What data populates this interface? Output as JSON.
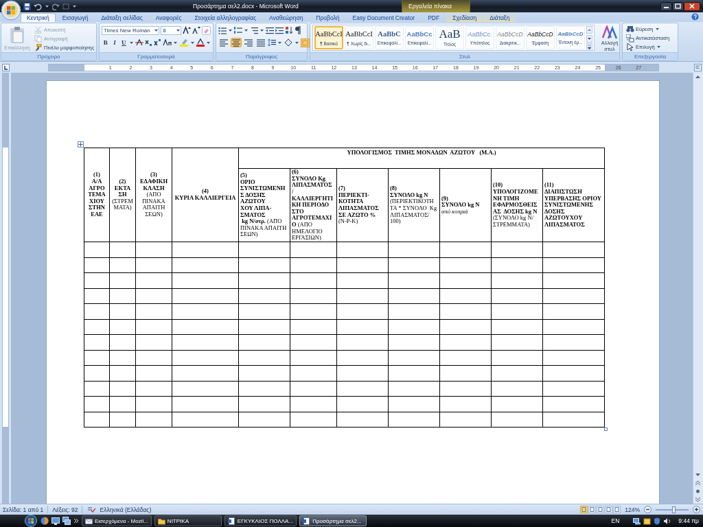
{
  "window": {
    "title": "Προσάρτημα σελ2.docx - Microsoft Word",
    "contextual_group": "Εργαλεία πίνακα"
  },
  "tabs": [
    {
      "label": "Κεντρική",
      "selected": true,
      "kind": "main"
    },
    {
      "label": "Εισαγωγή",
      "selected": false,
      "kind": "main"
    },
    {
      "label": "Διάταξη σελίδας",
      "selected": false,
      "kind": "main"
    },
    {
      "label": "Αναφορές",
      "selected": false,
      "kind": "main"
    },
    {
      "label": "Στοιχεία αλληλογραφίας",
      "selected": false,
      "kind": "main"
    },
    {
      "label": "Αναθεώρηση",
      "selected": false,
      "kind": "main"
    },
    {
      "label": "Προβολή",
      "selected": false,
      "kind": "main"
    },
    {
      "label": "Easy Document Creator",
      "selected": false,
      "kind": "main"
    },
    {
      "label": "PDF",
      "selected": false,
      "kind": "main"
    },
    {
      "label": "Σχεδίαση",
      "selected": false,
      "kind": "contextual"
    },
    {
      "label": "Διάταξη",
      "selected": false,
      "kind": "contextual"
    }
  ],
  "clipboard": {
    "label": "Πρόχειρο",
    "paste": {
      "label": "Επικόλληση",
      "disabled": true
    },
    "items": [
      {
        "label": "Αποκοπή",
        "disabled": true
      },
      {
        "label": "Αντιγραφή",
        "disabled": true
      },
      {
        "label": "Πινέλο μορφοποίησης",
        "disabled": false
      }
    ]
  },
  "font": {
    "label": "Γραμματοσειρά",
    "font_name": "Times New Roman",
    "font_size": "8",
    "format_buttons": [
      {
        "label": "B"
      },
      {
        "label": "I"
      },
      {
        "label": "U"
      }
    ]
  },
  "paragraph": {
    "label": "Παράγραφος",
    "alignments": [
      {
        "kind": "left",
        "selected": false
      },
      {
        "kind": "center",
        "selected": true
      },
      {
        "kind": "right",
        "selected": false
      },
      {
        "kind": "justify",
        "selected": false
      }
    ]
  },
  "styles": {
    "label": "Στυλ",
    "change_styles": "Αλλαγή στυλ",
    "items": [
      {
        "preview": "AaBbCcI",
        "name": "¶ Βασικό",
        "kind": "normal",
        "selected": true
      },
      {
        "preview": "AaBbCcI",
        "name": "¶ Χωρίς δι...",
        "kind": "normal",
        "selected": false
      },
      {
        "preview": "AaBbC",
        "name": "Επικεφαλί...",
        "kind": "heading1",
        "selected": false
      },
      {
        "preview": "AaBbCc",
        "name": "Επικεφαλί...",
        "kind": "heading2",
        "selected": false
      },
      {
        "preview": "AaB",
        "name": "Τίτλος",
        "kind": "title",
        "selected": false
      },
      {
        "preview": "AaBbCc.",
        "name": "Υπότιτλος",
        "kind": "subtitle",
        "selected": false
      },
      {
        "preview": "AaBbCcD",
        "name": "Διακριτικ...",
        "kind": "subtle",
        "selected": false
      },
      {
        "preview": "AaBbCcD",
        "name": "Έμφαση",
        "kind": "emphasis",
        "selected": false
      },
      {
        "preview": "AaBbCcD",
        "name": "Έντονη έμ...",
        "kind": "intense",
        "selected": false
      }
    ]
  },
  "editing": {
    "label": "Επεξεργασία",
    "items": [
      {
        "label": "Εύρεση",
        "kind": "find"
      },
      {
        "label": "Αντικατάσταση",
        "kind": "replace"
      },
      {
        "label": "Επιλογή",
        "kind": "select"
      }
    ]
  },
  "ruler": {
    "numbers": [
      "1",
      "2",
      "3",
      "4",
      "5",
      "6",
      "7",
      "8",
      "9",
      "10",
      "11",
      "12",
      "13",
      "14",
      "15",
      "16",
      "17",
      "18",
      "19",
      "20",
      "21",
      "22",
      "23",
      "24",
      "25",
      "26",
      "27"
    ]
  },
  "table": {
    "title": "ΥΠΟΛΟΓΙΣΜΟΣ  ΤΙΜΗΣ ΜΟΝΑΔΩΝ  ΑΖΩΤΟΥ   (Μ.Α.)",
    "header_cells": [
      "**(1)**\n**Α/Α**\n**ΑΓΡΟ**\n**ΤΕΜΑ**\n**ΧΙΟΥ**\n**ΣΤΗΝ**\n**ΕΑΕ**",
      "**(2)**\n**ΕΚΤΑ**\n**ΣΗ**\n(ΣΤΡΕΜ\nΜΑΤΑ)",
      "**(3)**\n**ΕΔΑΦΙΚΗ**\n**ΚΛΑΣΗ**\n(ΑΠΟ\nΠΙΝΑΚΑ\nΑΠΑΙΤΗ\nΣΕΩΝ)",
      "**(4)**\n**ΚΥΡΙΑ ΚΑΛΛΙΕΡΓΕΙΑ**",
      "**(5)**\n**ΟΡΙΟ**\n**ΣΥΝΙΣΤΩΜΕΝΗ**\n**Σ ΔΟΣΗΣ**\n**ΑΖΩΤΟΥ**\n**ΧΟΥ ΛΙΠΑ-**\n**ΣΜΑΤΟΣ**\n **kg Ν/στρ.** (ΑΠΟ\nΠΙΝΑΚΑ ΑΠΑΙΤΗ\nΣΕΩΝ)",
      "**(6)**\n**ΣΥΝΟΛΟ Kg**\n**ΛΙΠΑΣΜΑΤΟΣ**\n**/**\n**ΚΑΛΛΙΕΡΓΗΤΙ**\n**ΚΗ ΠΕΡΙΟΔΟ**\n**ΣΤΟ**\n**ΑΓΡΟΤΕΜΑΧΙ**\n**Ο** (ΑΠΟ\nΗΜΕΛΟΓΙΟ\nΕΡΓΑΣΙΩΝ)",
      "**(7)**\n**ΠΕΡΙΕΚΤΙ-**\n**ΚΟΤΗΤΑ**\n**ΛΙΠΑΣΜΑΤΟΣ**\n**ΣΕ ΑΖΩΤΟ %**\n(N-P-K)",
      "**(8)**\n**ΣΥΝΟΛΟ kg N**\n(ΠΕΡΙΕΚΤΙΚΟΤΗ\nΤΑ * ΣΥΝΟΛΟ  Kg\nΛΙΠΑΣΜΑΤΟΣ/\n100)",
      "**(9)**\n**ΣΥΝΟΛΟ kg N**\n*από κοπριά*",
      "**(10)**\n**ΥΠΟΛΟΓΙΖΟΜΕ**\n**ΝΗ ΤΙΜΗ**\n**ΕΦΑΡΜΟΣΘΕΙΣ**\n**ΑΣ  ΔΟΣΗΣ kg N**\n(ΣΥΝΟΛΟ kg N/\nΣΤΡΕΜΜΑΤΑ)",
      "**(11)**\n**ΔΙΑΠΙΣΤΩΣΗ**\n**ΥΠΕΡΒΑΣΗΣ ΟΡΙΟΥ**\n**ΣΥΝΙΣΤΩΜΕΝΗΣ**\n**ΔΟΣΗΣ**\n**ΑΖΩΤΟΥΧΟΥ**\n**ΛΙΠΑΣΜΑΤΟΣ**"
    ],
    "body_rows": [
      {
        "kind": "empty"
      },
      {
        "kind": "empty"
      },
      {
        "kind": "empty"
      },
      {
        "kind": "empty"
      },
      {
        "kind": "empty"
      },
      {
        "kind": "empty"
      },
      {
        "kind": "empty"
      },
      {
        "kind": "empty"
      },
      {
        "kind": "empty"
      },
      {
        "kind": "empty"
      },
      {
        "kind": "empty"
      },
      {
        "kind": "empty"
      }
    ]
  },
  "status_bar": {
    "page": "Σελίδα: 1 από 1",
    "words": "Λέξεις: 92",
    "language": "Ελληνικά (Ελλάδας)",
    "zoom": "124%",
    "zoom_slider": {
      "level": 0.55
    }
  },
  "taskbar": {
    "items": [
      {
        "label": "Εισερχόμενα - Mozil...",
        "selected": false,
        "kind": "mail"
      },
      {
        "label": "ΝΙΤΡΙΚΑ",
        "selected": false,
        "kind": "folder"
      },
      {
        "label": "ΕΓΚΥΚΛΙΟΣ ΠΟΛΛΑ...",
        "selected": false,
        "kind": "document"
      },
      {
        "label": "Προσάρτημα σελ2...",
        "selected": true,
        "kind": "document"
      }
    ],
    "language": "EN",
    "clock": "9:44 πμ"
  }
}
